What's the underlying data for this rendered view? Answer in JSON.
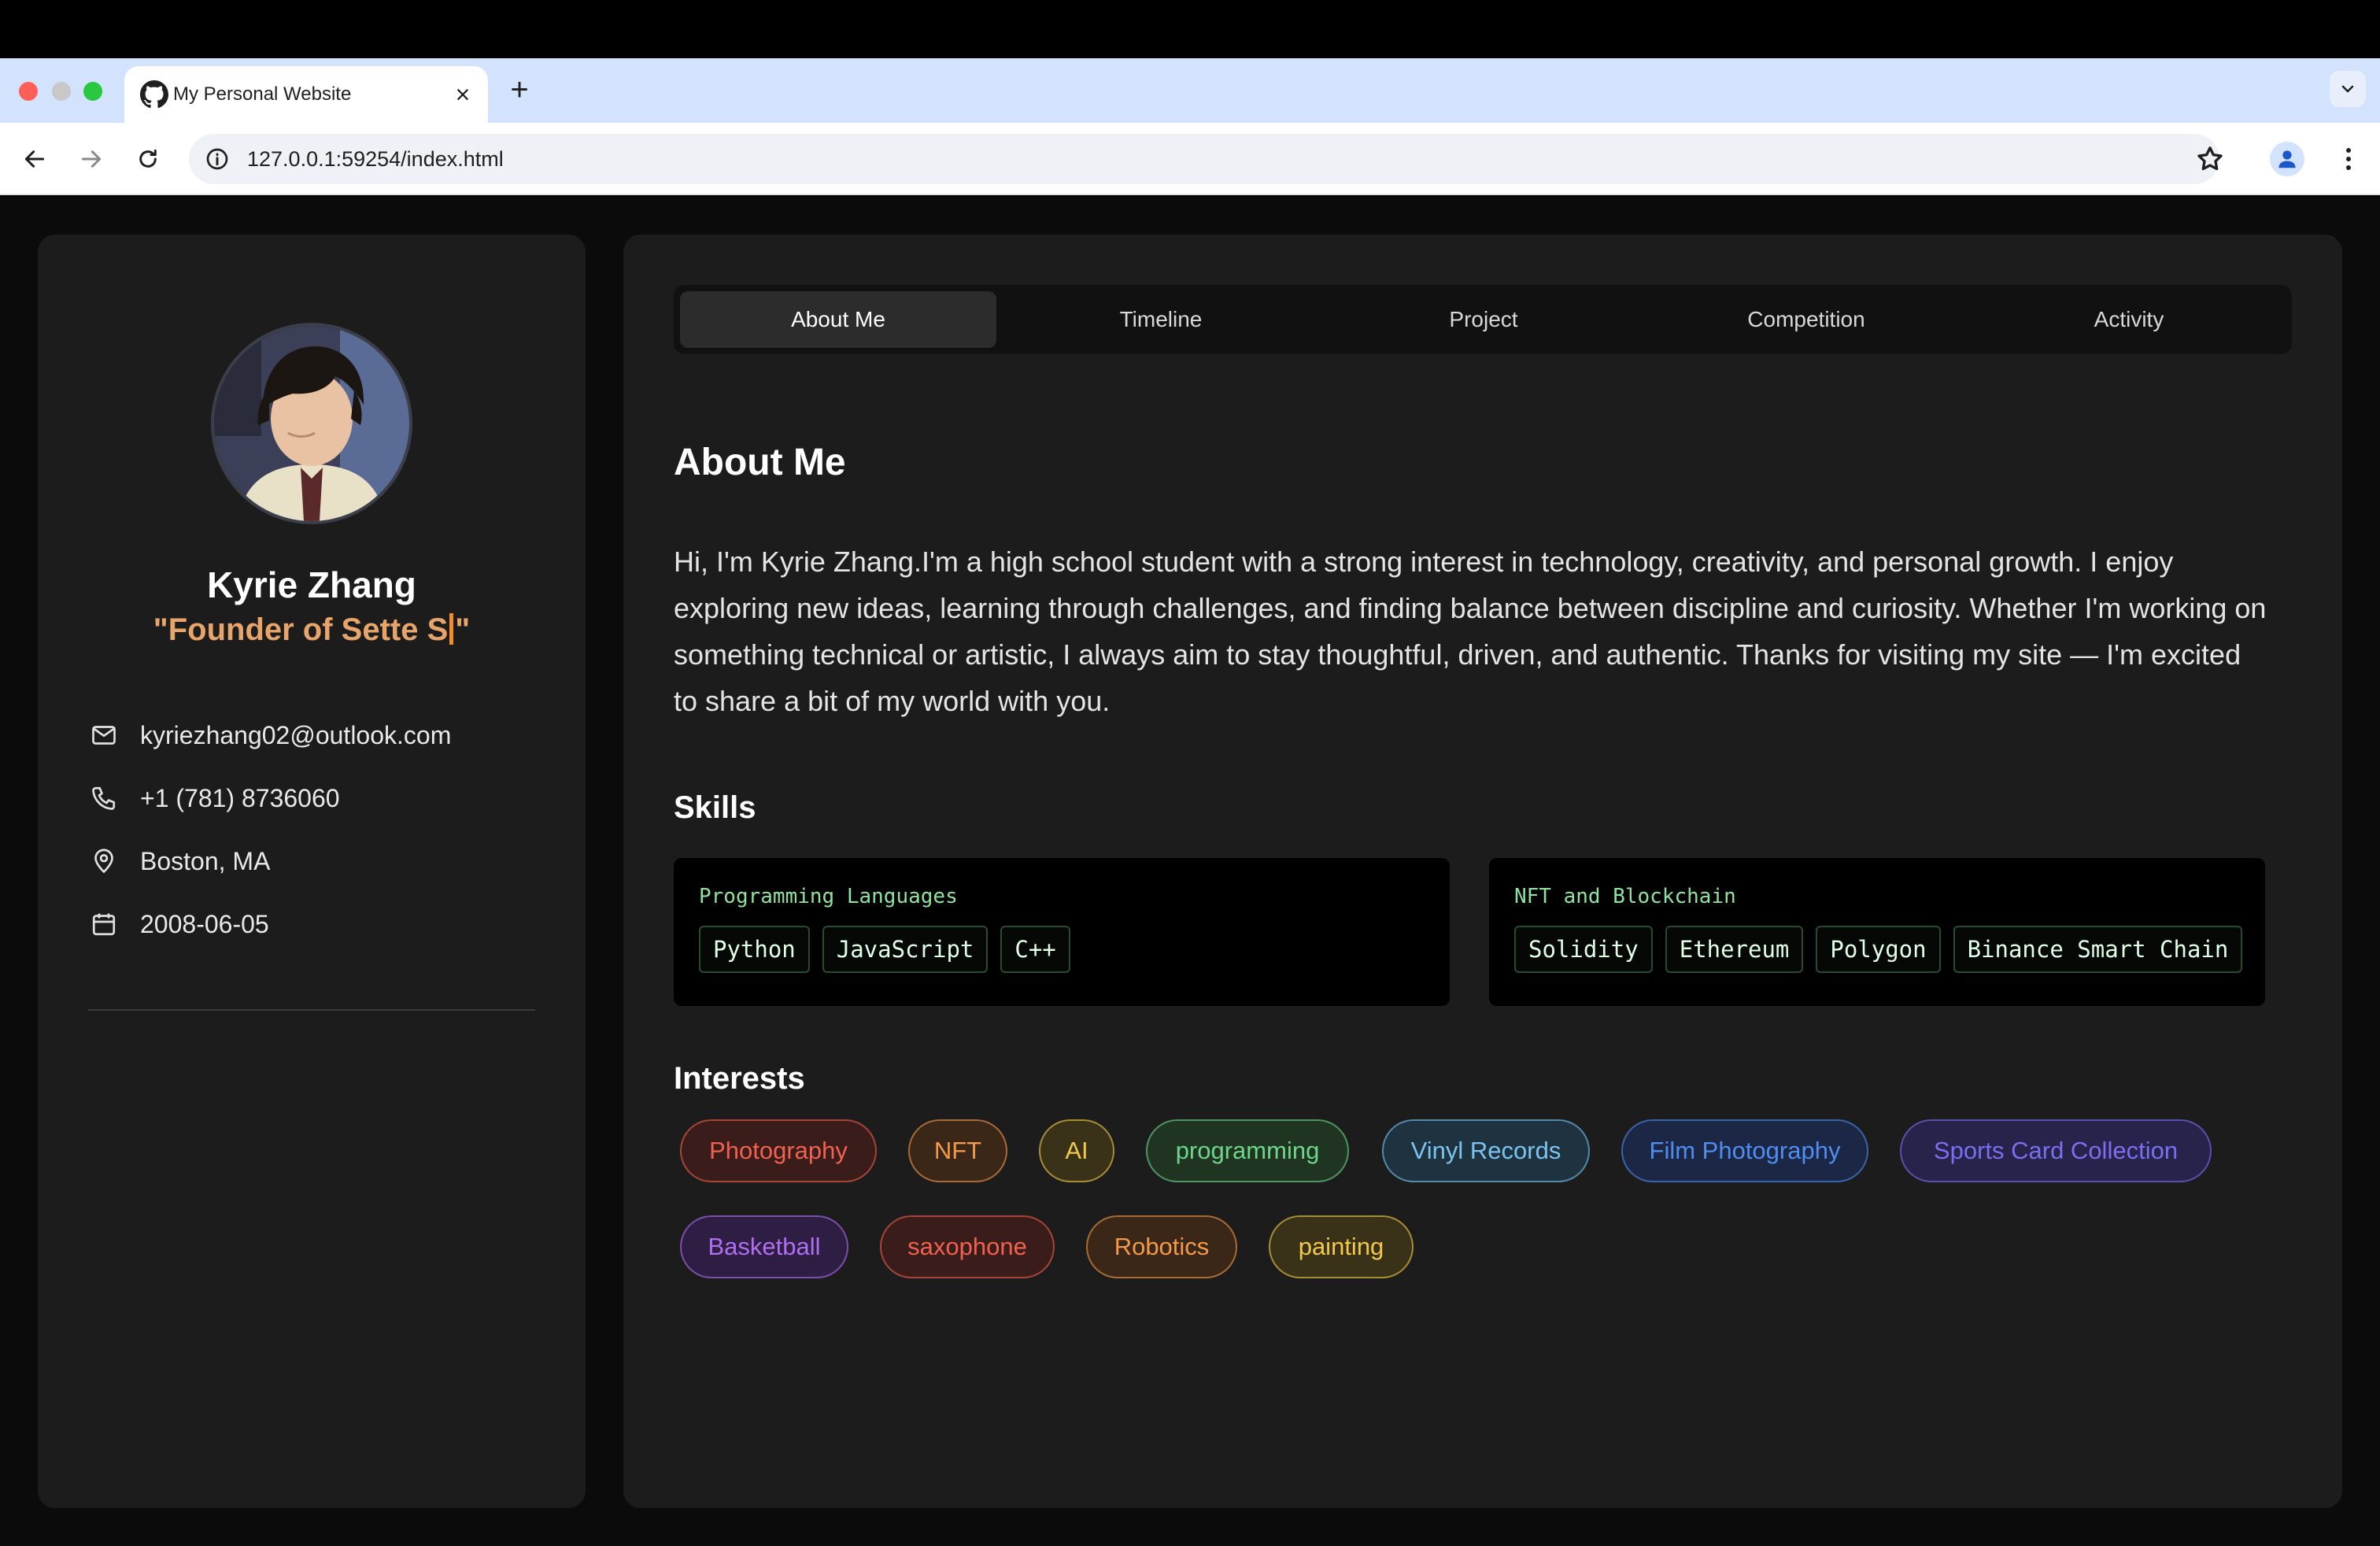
{
  "browser": {
    "tab_title": "My Personal Website",
    "url": "127.0.0.1:59254/index.html"
  },
  "profile": {
    "name": "Kyrie Zhang",
    "subtitle_open": "\"Founder of Sette S",
    "subtitle_close": "\"",
    "email": "kyriezhang02@outlook.com",
    "phone": "+1 (781) 8736060",
    "location": "Boston, MA",
    "birthdate": "2008-06-05"
  },
  "tabs": [
    "About Me",
    "Timeline",
    "Project",
    "Competition",
    "Activity"
  ],
  "about": {
    "heading": "About Me",
    "text": "Hi, I'm Kyrie Zhang.I'm a high school student with a strong interest in technology, creativity, and personal growth. I enjoy exploring new ideas, learning through challenges, and finding balance between discipline and curiosity. Whether I'm working on something technical or artistic, I always aim to stay thoughtful, driven, and authentic. Thanks for visiting my site — I'm excited to share a bit of my world with you."
  },
  "skills": {
    "heading": "Skills",
    "groups": [
      {
        "title": "Programming Languages",
        "items": [
          "Python",
          "JavaScript",
          "C++"
        ]
      },
      {
        "title": "NFT and Blockchain",
        "items": [
          "Solidity",
          "Ethereum",
          "Polygon",
          "Binance Smart Chain"
        ]
      }
    ]
  },
  "interests": {
    "heading": "Interests",
    "items": [
      {
        "label": "Photography",
        "color": "#f0614f",
        "bg": "#3a1d1b"
      },
      {
        "label": "NFT",
        "color": "#f39a4a",
        "bg": "#3a2718"
      },
      {
        "label": "AI",
        "color": "#f2c94c",
        "bg": "#3a3218"
      },
      {
        "label": "programming",
        "color": "#6fd58a",
        "bg": "#1f3522"
      },
      {
        "label": "Vinyl Records",
        "color": "#7cc4f0",
        "bg": "#1e3240"
      },
      {
        "label": "Film Photography",
        "color": "#4f8ef0",
        "bg": "#1b2744"
      },
      {
        "label": "Sports Card Collection",
        "color": "#7a6ff0",
        "bg": "#27234a"
      },
      {
        "label": "Basketball",
        "color": "#b06ff0",
        "bg": "#2e1e44"
      },
      {
        "label": "saxophone",
        "color": "#f0614f",
        "bg": "#3a1d1b"
      },
      {
        "label": "Robotics",
        "color": "#f39a4a",
        "bg": "#3a2718"
      },
      {
        "label": "painting",
        "color": "#f2c94c",
        "bg": "#3a3218"
      }
    ]
  }
}
